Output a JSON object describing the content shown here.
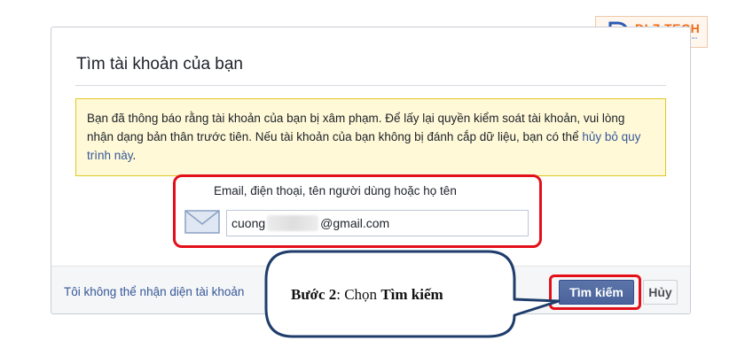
{
  "dialog": {
    "title": "Tìm tài khoản của bạn",
    "notice": {
      "text": "Bạn đã thông báo rằng tài khoản của bạn bị xâm phạm. Để lấy lại quyền kiểm soát tài khoản, vui lòng nhận dạng bản thân trước tiên. Nếu tài khoản của bạn không bị đánh cắp dữ liệu, bạn có thể ",
      "link": "hủy bỏ quy trình này",
      "end": "."
    },
    "search": {
      "label": "Email, điện thoại, tên người dùng hoặc họ tên",
      "value_prefix": "cuong",
      "value_suffix": "@gmail.com",
      "icon": "envelope-icon"
    },
    "footer": {
      "link": "Tôi không thể nhận diện tài khoản",
      "search_button": "Tìm kiếm",
      "cancel_button": "Hủy"
    }
  },
  "annotation": {
    "step": "Bước 2",
    "separator": ": Chọn ",
    "action": "Tìm kiếm"
  },
  "logo": {
    "text": "DLZ TECH"
  },
  "colors": {
    "primary_button": "#4e69a2",
    "link": "#365899",
    "highlight": "#e3101a",
    "notice_bg": "#fff9d7",
    "notice_border": "#e2c822",
    "callout_border": "#1f3d6b",
    "logo_accent": "#ef6a15"
  }
}
